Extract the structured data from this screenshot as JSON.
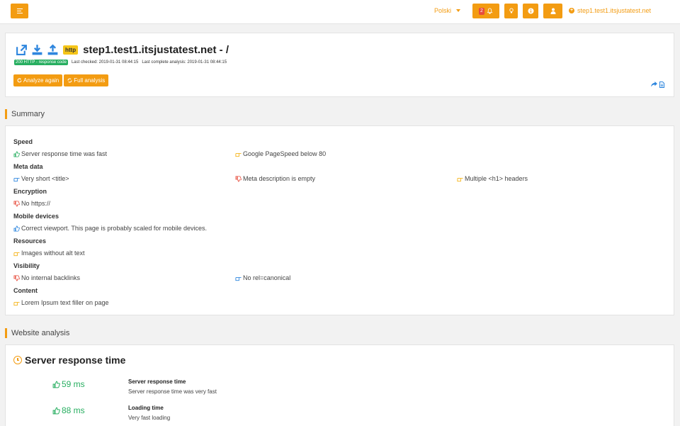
{
  "topbar": {
    "language": "Polski",
    "alerts_count": "2",
    "site": "step1.test1.itsjustatest.net"
  },
  "header": {
    "protocol_badge": "http",
    "title": "step1.test1.itsjustatest.net - /",
    "status_badge": "200 HTTP - response code",
    "last_checked": "Last checked: 2019-01-31 08:44:15",
    "last_complete": "Last complete analysis: 2019-01-31 08:44:15",
    "analyze_again": "Analyze again",
    "full_analysis": "Full analysis"
  },
  "summary": {
    "heading": "Summary",
    "categories": [
      {
        "name": "Speed",
        "items": [
          {
            "text": "Server response time was fast",
            "status": "good"
          },
          {
            "text": "Google PageSpeed below 80",
            "status": "warning"
          }
        ]
      },
      {
        "name": "Meta data",
        "items": [
          {
            "text": "Very short <title>",
            "status": "info"
          },
          {
            "text": "Meta description is empty",
            "status": "bad"
          },
          {
            "text": "Multiple <h1> headers",
            "status": "warning"
          }
        ]
      },
      {
        "name": "Encryption",
        "items": [
          {
            "text": "No https://",
            "status": "bad"
          }
        ]
      },
      {
        "name": "Mobile devices",
        "items": [
          {
            "text": "Correct viewport. This page is probably scaled for mobile devices.",
            "status": "info-up"
          }
        ]
      },
      {
        "name": "Resources",
        "items": [
          {
            "text": "Images without alt text",
            "status": "warning"
          }
        ]
      },
      {
        "name": "Visibility",
        "items": [
          {
            "text": "No internal backlinks",
            "status": "bad"
          },
          {
            "text": "No rel=canonical",
            "status": "info"
          }
        ]
      },
      {
        "name": "Content",
        "items": [
          {
            "text": "Lorem Ipsum text filler on page",
            "status": "warning"
          }
        ]
      }
    ]
  },
  "analysis": {
    "heading": "Website analysis",
    "title": "Server response time",
    "metrics": [
      {
        "value": "59 ms",
        "label": "Server response time",
        "desc": "Server response time was very fast"
      },
      {
        "value": "88 ms",
        "label": "Loading time",
        "desc": "Very fast loading"
      }
    ]
  },
  "colors": {
    "accent": "#f39c12",
    "good": "#27ae60",
    "info": "#2e86de",
    "bad": "#e74c3c",
    "warning": "#f5b316"
  },
  "icons": [
    "menu-icon",
    "bell-icon",
    "lightbulb-icon",
    "info-icon",
    "user-icon",
    "plus-circle-icon",
    "external-link-icon",
    "download-icon",
    "upload-icon",
    "refresh-icon",
    "share-icon",
    "document-icon",
    "thumbs-up-icon",
    "thumbs-down-icon",
    "pointing-hand-icon",
    "clock-icon"
  ]
}
